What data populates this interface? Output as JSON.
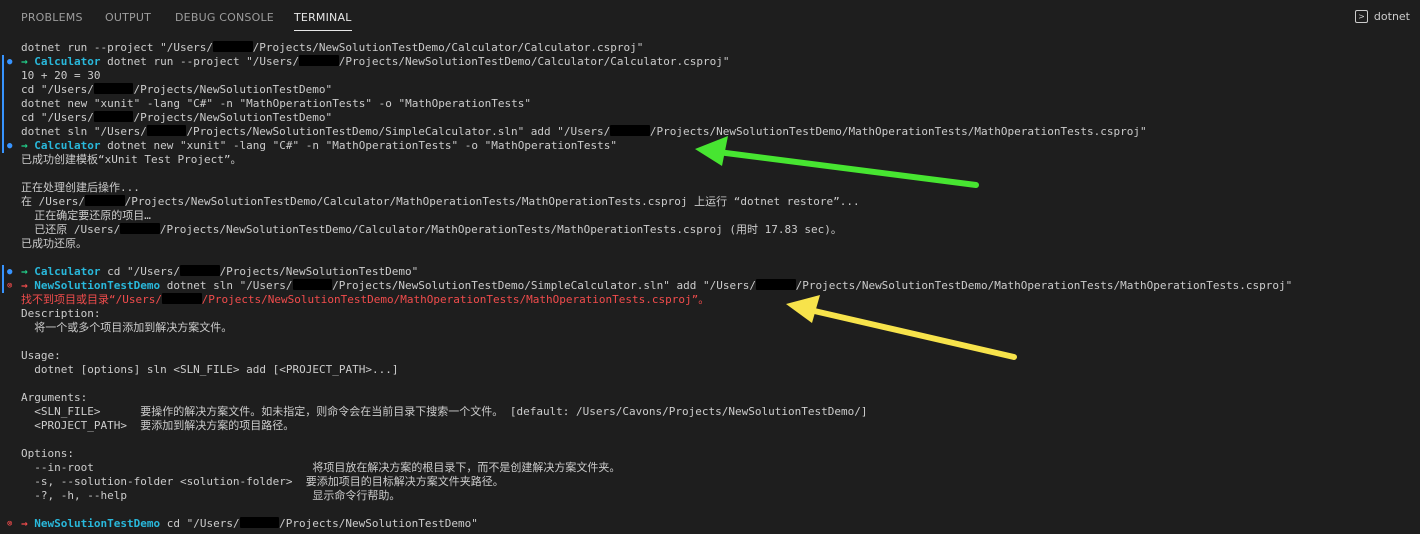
{
  "tabs": [
    "PROBLEMS",
    "OUTPUT",
    "DEBUG CONSOLE",
    "TERMINAL"
  ],
  "active_tab": "TERMINAL",
  "terminal_name": "dotnet",
  "colors": {
    "prompt_arrow_ok": "#23d18b",
    "prompt_arrow_err": "#f14c4c",
    "cwd": "#29b8db",
    "error_text": "#f14c4c",
    "annotation_green": "#47e531",
    "annotation_yellow": "#f7e34b"
  },
  "lines": [
    {
      "text": "dotnet run --project \"/Users/",
      "redact": 6,
      "tail": "/Projects/NewSolutionTestDemo/Calculator/Calculator.csproj\""
    },
    {
      "prompt": "Calculator",
      "mark": "blue",
      "text": "dotnet run --project \"/Users/",
      "redact": 6,
      "tail": "/Projects/NewSolutionTestDemo/Calculator/Calculator.csproj\""
    },
    {
      "text": "10 + 20 = 30"
    },
    {
      "text": "cd \"/Users/",
      "redact": 6,
      "tail": "/Projects/NewSolutionTestDemo\""
    },
    {
      "text": "dotnet new \"xunit\" -lang \"C#\" -n \"MathOperationTests\" -o \"MathOperationTests\""
    },
    {
      "text": "cd \"/Users/",
      "redact": 6,
      "tail": "/Projects/NewSolutionTestDemo\""
    },
    {
      "text": "dotnet sln \"/Users/",
      "redact": 6,
      "tail": "/Projects/NewSolutionTestDemo/SimpleCalculator.sln\" add \"/Users/",
      "redact2": 6,
      "tail2": "/Projects/NewSolutionTestDemo/MathOperationTests/MathOperationTests.csproj\""
    },
    {
      "prompt": "Calculator",
      "mark": "blue",
      "text": "dotnet new \"xunit\" -lang \"C#\" -n \"MathOperationTests\" -o \"MathOperationTests\""
    },
    {
      "text": "已成功创建模板“xUnit Test Project”。"
    },
    {
      "text": ""
    },
    {
      "text": "正在处理创建后操作..."
    },
    {
      "text": "在 /Users/",
      "redact": 6,
      "tail": "/Projects/NewSolutionTestDemo/Calculator/MathOperationTests/MathOperationTests.csproj 上运行 “dotnet restore”..."
    },
    {
      "text": "  正在确定要还原的项目…"
    },
    {
      "text": "  已还原 /Users/",
      "redact": 6,
      "tail": "/Projects/NewSolutionTestDemo/Calculator/MathOperationTests/MathOperationTests.csproj (用时 17.83 sec)。"
    },
    {
      "text": "已成功还原。"
    },
    {
      "text": ""
    },
    {
      "prompt": "Calculator",
      "mark": "blue",
      "text": "cd \"/Users/",
      "redact": 6,
      "tail": "/Projects/NewSolutionTestDemo\""
    },
    {
      "prompt": "NewSolutionTestDemo",
      "mark": "red",
      "text": "dotnet sln \"/Users/",
      "redact": 6,
      "tail": "/Projects/NewSolutionTestDemo/SimpleCalculator.sln\" add \"/Users/",
      "redact2": 6,
      "tail2": "/Projects/NewSolutionTestDemo/MathOperationTests/MathOperationTests.csproj\""
    },
    {
      "error": true,
      "text": "找不到项目或目录“/Users/",
      "redact": 6,
      "tail": "/Projects/NewSolutionTestDemo/MathOperationTests/MathOperationTests.csproj”。"
    },
    {
      "text": "Description:"
    },
    {
      "text": "  将一个或多个项目添加到解决方案文件。"
    },
    {
      "text": ""
    },
    {
      "text": "Usage:"
    },
    {
      "text": "  dotnet [options] sln <SLN_FILE> add [<PROJECT_PATH>...]"
    },
    {
      "text": ""
    },
    {
      "text": "Arguments:"
    },
    {
      "text": "  <SLN_FILE>      要操作的解决方案文件。如未指定，则命令会在当前目录下搜索一个文件。 [default: /Users/Cavons/Projects/NewSolutionTestDemo/]"
    },
    {
      "text": "  <PROJECT_PATH>  要添加到解决方案的项目路径。"
    },
    {
      "text": ""
    },
    {
      "text": "Options:"
    },
    {
      "text": "  --in-root                                 将项目放在解决方案的根目录下，而不是创建解决方案文件夹。"
    },
    {
      "text": "  -s, --solution-folder <solution-folder>  要添加项目的目标解决方案文件夹路径。"
    },
    {
      "text": "  -?, -h, --help                            显示命令行帮助。"
    },
    {
      "text": ""
    },
    {
      "prompt": "NewSolutionTestDemo",
      "mark": "red",
      "text": "cd \"/Users/",
      "redact": 6,
      "tail": "/Projects/NewSolutionTestDemo\""
    }
  ]
}
